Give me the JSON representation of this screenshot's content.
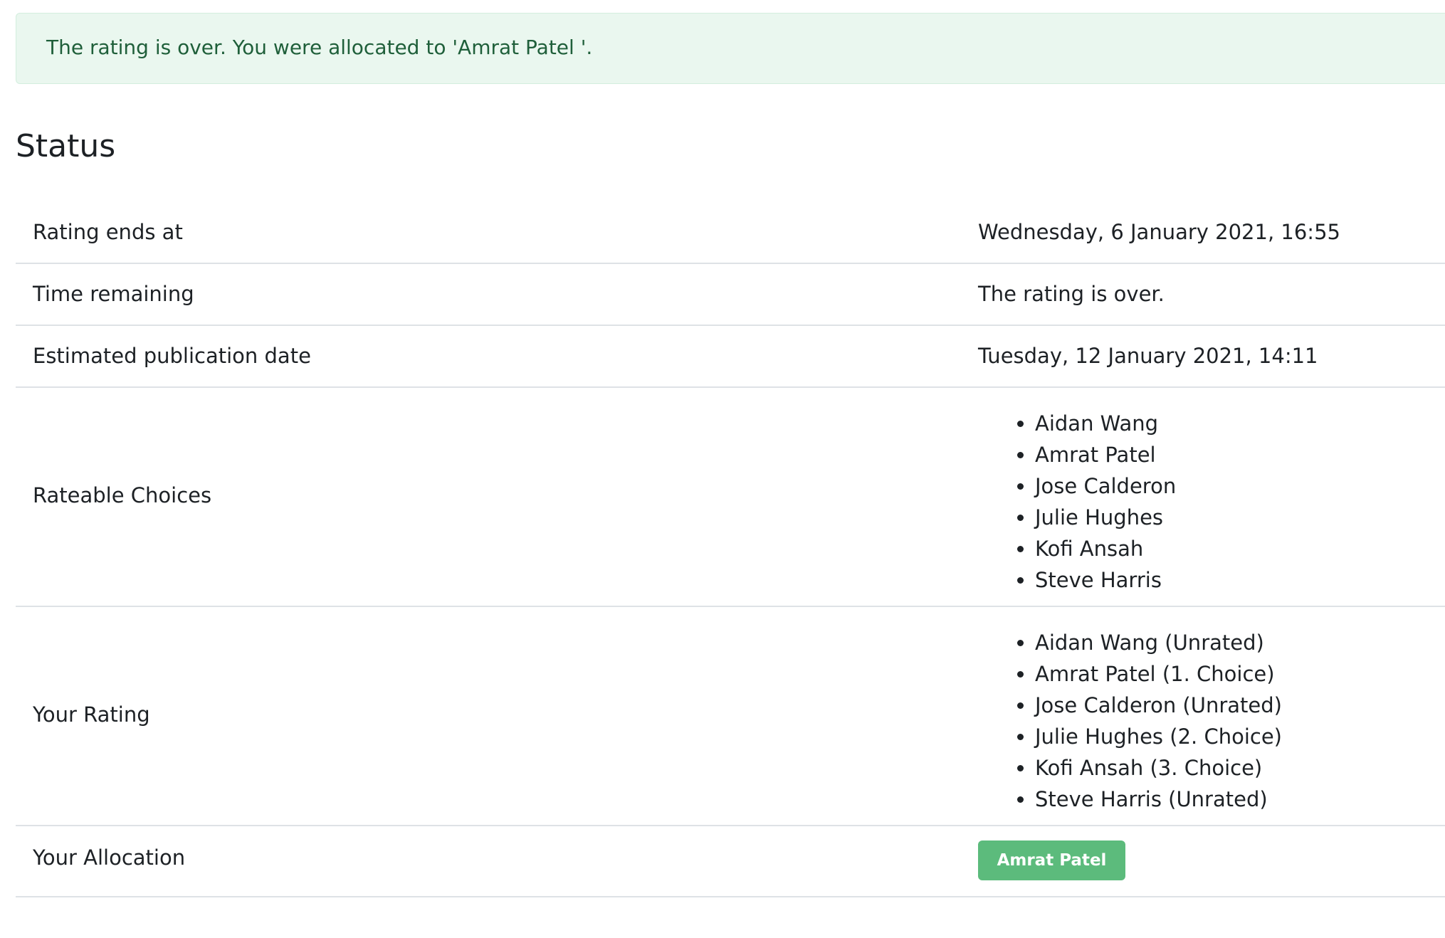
{
  "alert": {
    "message": "The rating is over. You were allocated to 'Amrat Patel '."
  },
  "status": {
    "title": "Status",
    "rows": {
      "rating_ends": {
        "label": "Rating ends at",
        "value": "Wednesday, 6 January 2021, 16:55"
      },
      "time_remaining": {
        "label": "Time remaining",
        "value": "The rating is over."
      },
      "publication_date": {
        "label": "Estimated publication date",
        "value": "Tuesday, 12 January 2021, 14:11"
      },
      "rateable_choices": {
        "label": "Rateable Choices",
        "items": [
          "Aidan Wang",
          "Amrat Patel",
          "Jose Calderon",
          "Julie Hughes",
          "Kofi Ansah",
          "Steve Harris"
        ]
      },
      "your_rating": {
        "label": "Your Rating",
        "items": [
          "Aidan Wang (Unrated)",
          "Amrat Patel (1. Choice)",
          "Jose Calderon (Unrated)",
          "Julie Hughes (2. Choice)",
          "Kofi Ansah (3. Choice)",
          "Steve Harris (Unrated)"
        ]
      },
      "your_allocation": {
        "label": "Your Allocation",
        "value": "Amrat Patel"
      }
    }
  },
  "colors": {
    "alert_background": "#eaf7ef",
    "alert_text": "#1f5f3a",
    "badge_background": "#5cbb7c",
    "row_divider": "#dee2e6"
  }
}
